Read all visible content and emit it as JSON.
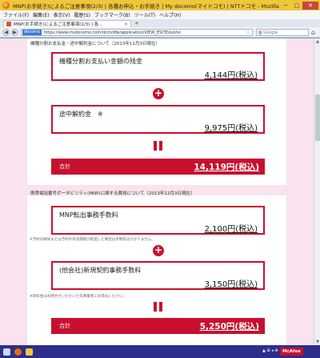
{
  "window": {
    "title": "MNP(お手続き)によるご注意事項(2/3) | 各種お申込・お手続き | My docomo(マイドコモ) | NTTドコモ - Mozilla Firefox",
    "min": "─",
    "max": "□",
    "close": "✕"
  },
  "menu": [
    "ファイル(F)",
    "編集(E)",
    "表示(V)",
    "履歴(S)",
    "ブックマーク(B)",
    "ツール(T)",
    "ヘルプ(H)"
  ],
  "tab": {
    "label": "MNP(お手続き)によるご注意事項(2/3) | 各...",
    "close": "×",
    "new": "+"
  },
  "nav": {
    "back": "◀",
    "forward": "▶",
    "site_badge": "docomo",
    "url": "https://www.mydocomo.com/dcm/dfw/application/VIEW_ESITE/est/sc",
    "star": "☆",
    "search_placeholder": "Google",
    "search_engine": "g",
    "home": "⌂"
  },
  "section1": {
    "title": "機種分割お支払金・途中解約金について（2013年12月3日現在）",
    "installment": {
      "label": "機種分割お支払い金額の残金",
      "value": "4,144円(税込)"
    },
    "plus": "+",
    "cancellation": {
      "label": "途中解約金　※",
      "value": "9,975円(税込)"
    },
    "total": {
      "label": "合計",
      "value": "14,119円(税込)"
    }
  },
  "section2": {
    "title": "携帯電話番号ポータビリティ(MNP)に関する費用について（2013年12月3日現在）",
    "mnp_fee": {
      "label": "MNP転出事務手数料",
      "value": "2,100円(税込)"
    },
    "mnp_note": "※予約の解除または予約の有効期限が経過した場合は手数料はかかりません。",
    "plus": "+",
    "new_contract": {
      "label": "(他会社)新規契約事務手数料",
      "value": "3,150円(税込)"
    },
    "contract_note": "※新料金はお問合せいただいた先事業者にお尋ねください。",
    "total": {
      "label": "合計",
      "value": "5,250円(税込)"
    }
  },
  "taskbar": {
    "tray": "▲ ⊞ ◂ ⊕",
    "mcafee": "McAfee"
  },
  "colors": {
    "accent": "#c8102e",
    "page_bg": "#f8e3ee",
    "taskbar": "#2c2f8a"
  }
}
